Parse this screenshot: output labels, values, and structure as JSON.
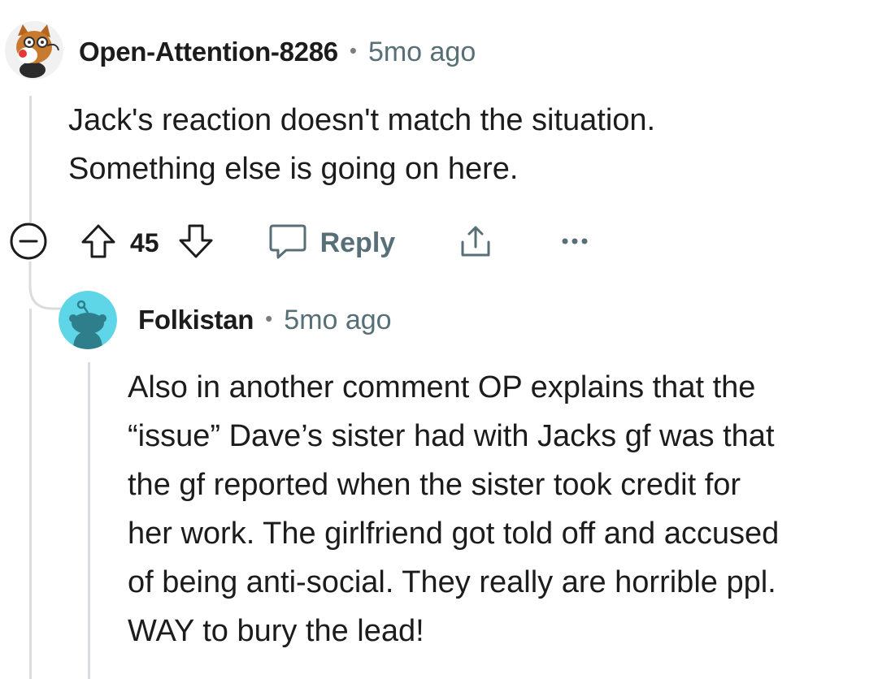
{
  "comments": [
    {
      "username": "Open-Attention-8286",
      "timestamp": "5mo ago",
      "body": [
        "Jack's reaction doesn't match the situation.",
        "Something else is going on here."
      ],
      "votes": "45",
      "reply_label": "Reply"
    },
    {
      "username": "Folkistan",
      "timestamp": "5mo ago",
      "body": [
        "Also in another comment OP explains that the",
        "“issue” Dave’s sister had with Jacks gf was that",
        "the gf reported when the sister took credit for",
        "her work. The girlfriend got told off and accused",
        "of being anti-social. They really are horrible ppl.",
        "WAY to bury the lead!"
      ]
    }
  ],
  "separator": "•",
  "colors": {
    "text": "#1c1c1c",
    "meta": "#576f76",
    "thread_line": "#d9dddf",
    "avatar2_bg": "#5fd6e8",
    "avatar2_fg": "#2e7e8c"
  },
  "icons": {
    "avatar1": "fox-avatar-icon",
    "avatar2": "reddit-snoo-avatar-icon",
    "collapse": "collapse-minus-icon",
    "upvote": "upvote-arrow-icon",
    "downvote": "downvote-arrow-icon",
    "reply": "speech-bubble-icon",
    "share": "share-icon",
    "more": "more-dots-icon"
  }
}
